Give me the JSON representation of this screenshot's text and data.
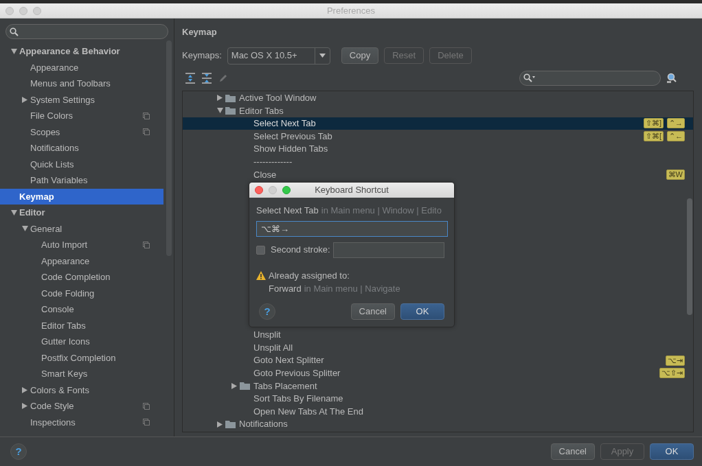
{
  "window": {
    "title": "Preferences"
  },
  "sidebar": {
    "items": [
      {
        "label": "Appearance & Behavior",
        "expanded": true,
        "selected": false,
        "bold": true,
        "children": [
          {
            "label": "Appearance",
            "selected": false
          },
          {
            "label": "Menus and Toolbars",
            "selected": false
          },
          {
            "label": "System Settings",
            "expanded": false,
            "selected": false
          },
          {
            "label": "File Colors",
            "selected": false,
            "project_level": true
          },
          {
            "label": "Scopes",
            "selected": false,
            "project_level": true
          },
          {
            "label": "Notifications",
            "selected": false
          },
          {
            "label": "Quick Lists",
            "selected": false
          },
          {
            "label": "Path Variables",
            "selected": false
          }
        ]
      },
      {
        "label": "Keymap",
        "selected": true,
        "bold": true
      },
      {
        "label": "Editor",
        "expanded": true,
        "selected": false,
        "bold": true,
        "children": [
          {
            "label": "General",
            "expanded": true,
            "selected": false,
            "children": [
              {
                "label": "Auto Import",
                "selected": false,
                "project_level": true
              },
              {
                "label": "Appearance",
                "selected": false
              },
              {
                "label": "Code Completion",
                "selected": false
              },
              {
                "label": "Code Folding",
                "selected": false
              },
              {
                "label": "Console",
                "selected": false
              },
              {
                "label": "Editor Tabs",
                "selected": false
              },
              {
                "label": "Gutter Icons",
                "selected": false
              },
              {
                "label": "Postfix Completion",
                "selected": false
              },
              {
                "label": "Smart Keys",
                "selected": false
              }
            ]
          },
          {
            "label": "Colors & Fonts",
            "expanded": false,
            "selected": false
          },
          {
            "label": "Code Style",
            "expanded": false,
            "selected": false,
            "project_level": true
          },
          {
            "label": "Inspections",
            "selected": false,
            "project_level": true
          }
        ]
      }
    ]
  },
  "page": {
    "title": "Keymap",
    "keymap_label": "Keymaps:",
    "keymap_value": "Mac OS X 10.5+",
    "buttons": [
      {
        "label": "Copy",
        "disabled": false
      },
      {
        "label": "Reset",
        "disabled": true
      },
      {
        "label": "Delete",
        "disabled": true
      }
    ],
    "tools": [
      {
        "kind": "expand_all",
        "disabled": false
      },
      {
        "kind": "collapse_all",
        "disabled": false
      },
      {
        "kind": "edit",
        "disabled": true
      }
    ],
    "tree": [
      {
        "label": "Active Tool Window",
        "kind": "folder",
        "expanded": false,
        "selected": false
      },
      {
        "label": "Editor Tabs",
        "kind": "folder",
        "expanded": true,
        "selected": false,
        "children": [
          {
            "label": "Select Next Tab",
            "kind": "action",
            "selected": true,
            "shortcuts": [
              "⇧⌘]",
              "⌃→"
            ]
          },
          {
            "label": "Select Previous Tab",
            "kind": "action",
            "selected": false,
            "shortcuts": [
              "⇧⌘[",
              "⌃←"
            ]
          },
          {
            "label": "Show Hidden Tabs",
            "kind": "action",
            "selected": false
          },
          {
            "label": "-------------",
            "kind": "action",
            "selected": false
          },
          {
            "label": "Close",
            "kind": "action",
            "selected": false,
            "shortcuts": [
              "⌘W"
            ]
          },
          {
            "label": "Unsplit",
            "kind": "action",
            "selected": false
          },
          {
            "label": "Unsplit All",
            "kind": "action",
            "selected": false
          },
          {
            "label": "Goto Next Splitter",
            "kind": "action",
            "selected": false,
            "shortcuts": [
              "⌥⇥"
            ]
          },
          {
            "label": "Goto Previous Splitter",
            "kind": "action",
            "selected": false,
            "shortcuts": [
              "⌥⇧⇥"
            ]
          },
          {
            "label": "Tabs Placement",
            "kind": "folder",
            "expanded": false,
            "selected": false
          },
          {
            "label": "Sort Tabs By Filename",
            "kind": "action",
            "selected": false
          },
          {
            "label": "Open New Tabs At The End",
            "kind": "action",
            "selected": false
          }
        ]
      },
      {
        "label": "Notifications",
        "kind": "folder",
        "expanded": false,
        "selected": false
      }
    ]
  },
  "dialog": {
    "title": "Keyboard Shortcut",
    "action": "Select Next Tab",
    "action_path": "in Main menu | Window | Edito",
    "first_stroke": "⌥⌘→",
    "second_stroke": {
      "label": "Second stroke:",
      "checked": false
    },
    "warning": "Already assigned to:",
    "conflict": "Forward",
    "conflict_path": "in Main menu | Navigate",
    "help": "?",
    "buttons": [
      {
        "label": "Cancel",
        "default": false
      },
      {
        "label": "OK",
        "default": true
      }
    ]
  },
  "footer": {
    "help": "?",
    "buttons": [
      {
        "label": "Cancel",
        "disabled": false,
        "default": false
      },
      {
        "label": "Apply",
        "disabled": true,
        "default": false
      },
      {
        "label": "OK",
        "disabled": false,
        "default": true
      }
    ]
  }
}
